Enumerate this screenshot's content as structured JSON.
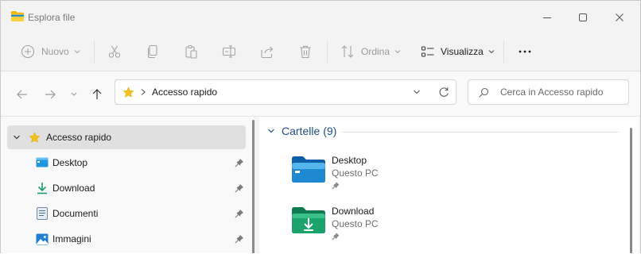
{
  "window": {
    "title": "Esplora file",
    "accent": "#f3c21c"
  },
  "toolbar": {
    "new_label": "Nuovo",
    "sort_label": "Ordina",
    "view_label": "Visualizza",
    "icons": [
      "cut-icon",
      "copy-icon",
      "paste-icon",
      "rename-icon",
      "share-icon",
      "delete-icon",
      "more-icon"
    ]
  },
  "address": {
    "path": "Accesso rapido"
  },
  "search": {
    "placeholder": "Cerca in Accesso rapido"
  },
  "sidebar": {
    "items": [
      {
        "label": "Accesso rapido",
        "icon": "star-icon",
        "selected": true
      },
      {
        "label": "Desktop",
        "icon": "desktop-icon",
        "pinned": true
      },
      {
        "label": "Download",
        "icon": "download-icon",
        "pinned": true
      },
      {
        "label": "Documenti",
        "icon": "documents-icon",
        "pinned": true
      },
      {
        "label": "Immagini",
        "icon": "pictures-icon",
        "pinned": true
      }
    ]
  },
  "main": {
    "section_label": "Cartelle",
    "section_count": "(9)",
    "folders": [
      {
        "name": "Desktop",
        "location": "Questo PC",
        "color": "#1e88d0"
      },
      {
        "name": "Download",
        "location": "Questo PC",
        "color": "#1aa36b"
      }
    ]
  }
}
